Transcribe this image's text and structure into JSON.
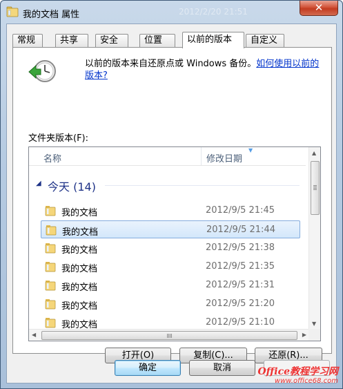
{
  "window": {
    "title": "我的文档 属性",
    "ghost_title": "2012/2/20 21:51",
    "close_label": "✕"
  },
  "tabs": [
    {
      "label": "常规"
    },
    {
      "label": "共享"
    },
    {
      "label": "安全"
    },
    {
      "label": "位置"
    },
    {
      "label": "以前的版本",
      "active": true
    },
    {
      "label": "自定义"
    }
  ],
  "description": {
    "text": "以前的版本来自还原点或 Windows 备份。",
    "link": "如何使用以前的版本?"
  },
  "folder_versions_label": "文件夹版本(F):",
  "list": {
    "col_name": "名称",
    "col_date": "修改日期",
    "group": {
      "label": "今天 (14)"
    },
    "rows": [
      {
        "name": "我的文档",
        "date": "2012/9/5 21:45"
      },
      {
        "name": "我的文档",
        "date": "2012/9/5 21:44",
        "selected": true
      },
      {
        "name": "我的文档",
        "date": "2012/9/5 21:38"
      },
      {
        "name": "我的文档",
        "date": "2012/9/5 21:35"
      },
      {
        "name": "我的文档",
        "date": "2012/9/5 21:31"
      },
      {
        "name": "我的文档",
        "date": "2012/9/5 21:20"
      },
      {
        "name": "我的文档",
        "date": "2012/9/5 21:10"
      }
    ]
  },
  "actions": {
    "open": "打开(O)",
    "copy": "复制(C)...",
    "restore": "还原(R)..."
  },
  "dialog": {
    "ok": "确定",
    "cancel": "取消"
  },
  "watermark": {
    "brand": "Office教程学习网",
    "url": "www.office68.com"
  },
  "colors": {
    "link": "#0033cc",
    "group_header": "#1e3287",
    "selection": "#d3e7fb",
    "watermark": "#e33333"
  }
}
